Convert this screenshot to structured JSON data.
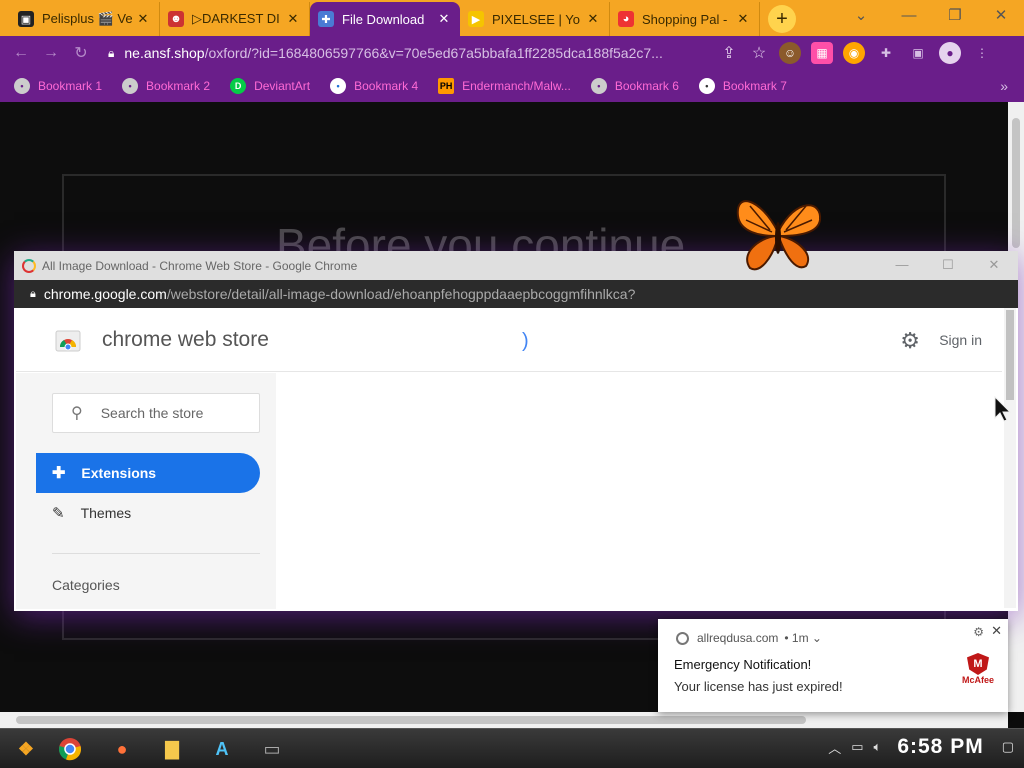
{
  "browser": {
    "tabs": [
      {
        "title": "Pelisplus 🎬 Ve",
        "fav_color": "#222"
      },
      {
        "title": "▷DARKEST DI",
        "fav_color": "#c33"
      },
      {
        "title": "File Download",
        "fav_color": "#4a7bd4"
      },
      {
        "title": "PIXELSEE | Yo",
        "fav_color": "#f5a623"
      },
      {
        "title": "Shopping Pal -",
        "fav_color": "#e33"
      }
    ],
    "new_tab_icon": "+",
    "url_domain": "ne.ansf.shop",
    "url_rest": "/oxford/?id=1684806597766&v=70e5ed67a5bbafa1ff2285dca188f5a2c7...",
    "bookmarks": [
      {
        "label": "Bookmark 1",
        "icon": "•"
      },
      {
        "label": "Bookmark 2",
        "icon": "•"
      },
      {
        "label": "DeviantArt",
        "icon": "D"
      },
      {
        "label": "Bookmark 4",
        "icon": "•"
      },
      {
        "label": "Endermanch/Malw...",
        "icon": "PH"
      },
      {
        "label": "Bookmark 6",
        "icon": "•"
      },
      {
        "label": "Bookmark 7",
        "icon": "•"
      }
    ],
    "bookmarks_more": "»"
  },
  "page": {
    "heading": "Before you continue"
  },
  "popup": {
    "window_title": "All Image Download - Chrome Web Store - Google Chrome",
    "url_domain": "chrome.google.com",
    "url_rest": "/webstore/detail/all-image-download/ehoanpfehogppdaaepbcoggmfihnlkca?",
    "brand": "chrome web store",
    "sign_in": "Sign in",
    "search_placeholder": "Search the store",
    "nav_extensions": "Extensions",
    "nav_themes": "Themes",
    "categories": "Categories"
  },
  "notification": {
    "source": "allreqdusa.com",
    "time": "• 1m ⌄",
    "title": "Emergency Notification!",
    "body": "Your  license has just expired!",
    "brand": "McAfee"
  },
  "taskbar": {
    "clock": "6:58 PM"
  },
  "colors": {
    "tabstrip": "#f5a623",
    "toolbar": "#6a1e8a",
    "bookmark_text": "#ff6ad5",
    "cws_accent": "#1a73e8",
    "mcafee_red": "#c01818"
  }
}
